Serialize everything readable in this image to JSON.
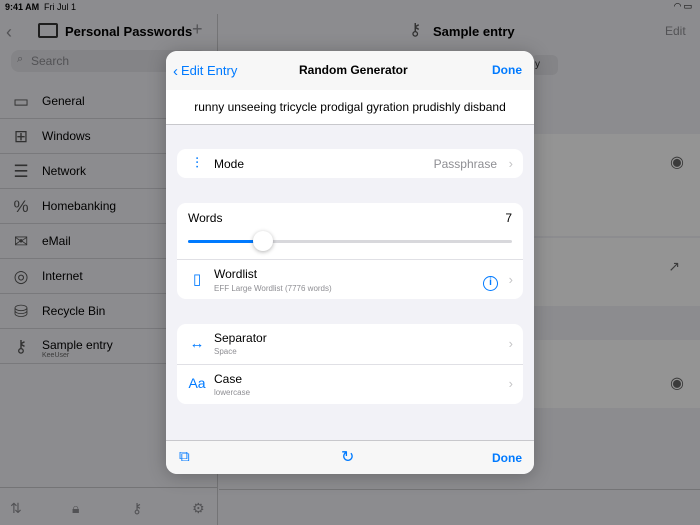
{
  "status_bar": {
    "time": "9:41 AM",
    "date": "Fri Jul 1",
    "right_icons": "wifi-icon battery-icon"
  },
  "sidebar": {
    "title": "Personal Passwords",
    "search_placeholder": "Search",
    "items": [
      {
        "label": "General",
        "icon": "folder-icon"
      },
      {
        "label": "Windows",
        "icon": "windows-icon"
      },
      {
        "label": "Network",
        "icon": "network-icon"
      },
      {
        "label": "Homebanking",
        "icon": "percent-icon"
      },
      {
        "label": "eMail",
        "icon": "mail-icon"
      },
      {
        "label": "Internet",
        "icon": "globe-icon"
      },
      {
        "label": "Recycle Bin",
        "icon": "database-icon"
      },
      {
        "label": "Sample entry",
        "sub": "KeeUser",
        "icon": "key-icon"
      }
    ]
  },
  "detail": {
    "title": "Sample entry",
    "edit_label": "Edit",
    "segment_text": "y"
  },
  "modal": {
    "back_label": "Edit Entry",
    "title": "Random Generator",
    "done_label": "Done",
    "generated_password": "runny unseeing tricycle prodigal gyration prudishly disband",
    "mode": {
      "label": "Mode",
      "value": "Passphrase"
    },
    "words": {
      "label": "Words",
      "value": "7",
      "slider_fraction": 0.23
    },
    "wordlist": {
      "label": "Wordlist",
      "sub": "EFF Large Wordlist (7776 words)"
    },
    "separator": {
      "label": "Separator",
      "sub": "Space"
    },
    "case": {
      "label": "Case",
      "sub": "lowercase"
    },
    "toolbar_done_label": "Done"
  },
  "colors": {
    "accent": "#007aff",
    "background": "#f2f2f7"
  }
}
